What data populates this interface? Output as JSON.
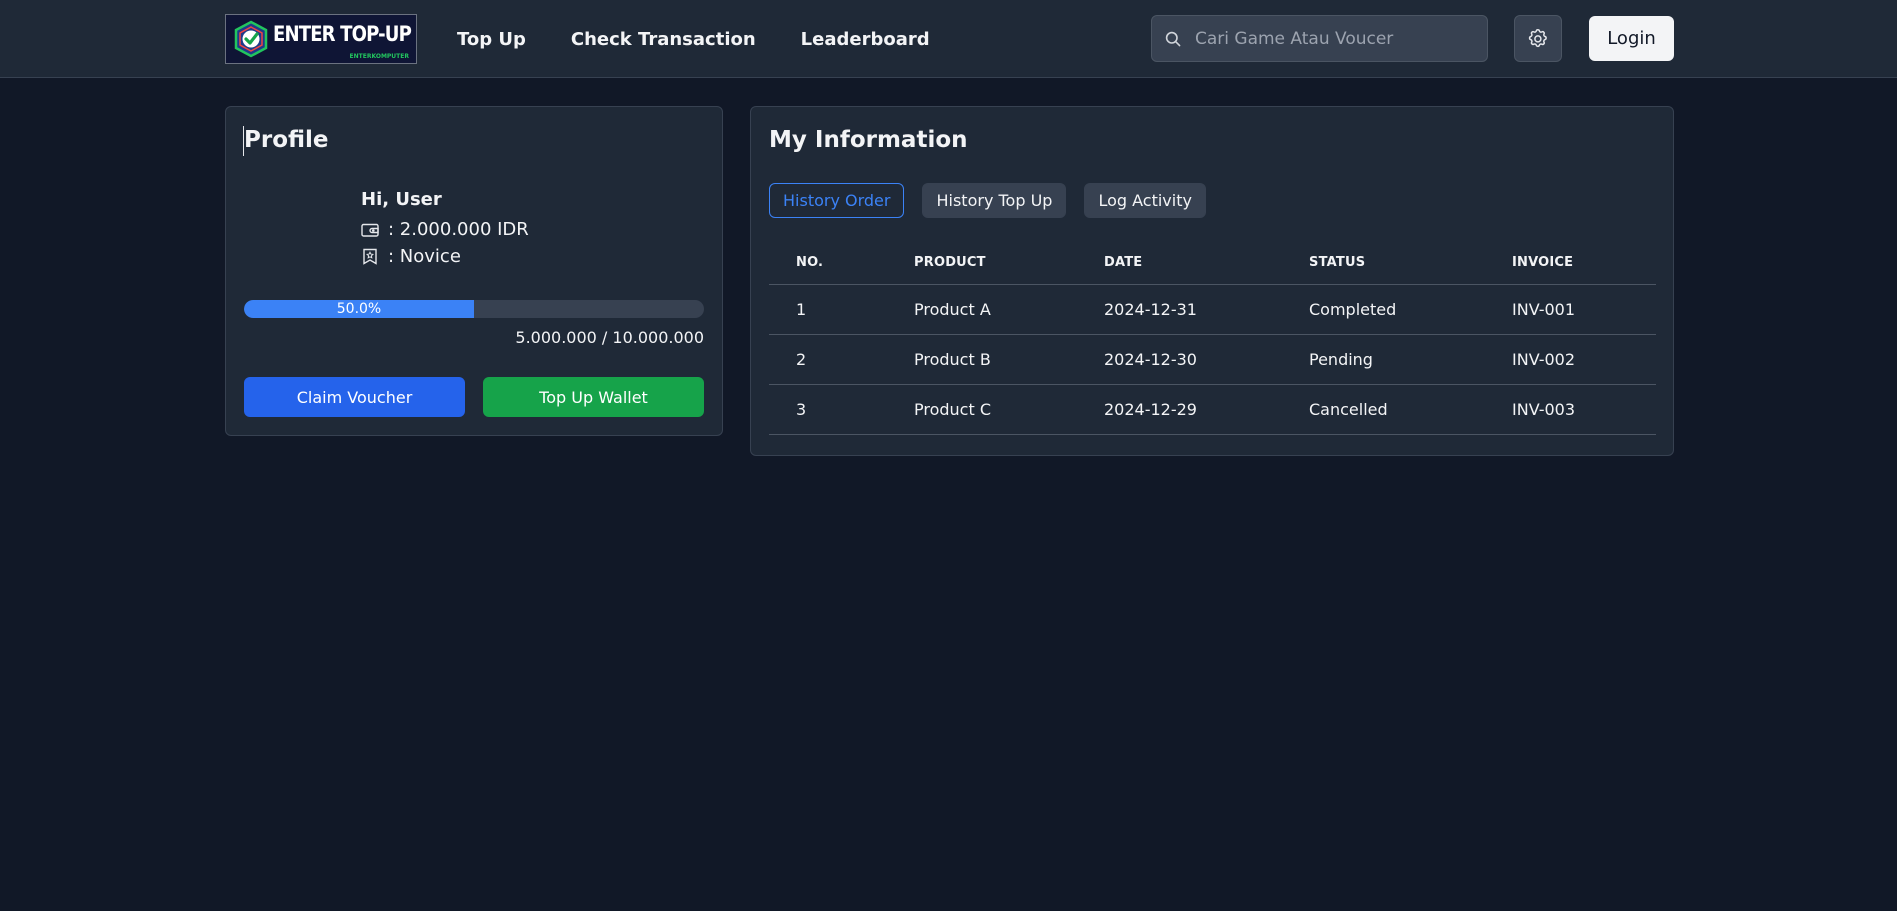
{
  "header": {
    "logo": {
      "text": "ENTER TOP-UP",
      "subtext": "ENTERKOMPUTER"
    },
    "nav": [
      {
        "label": "Top Up"
      },
      {
        "label": "Check Transaction"
      },
      {
        "label": "Leaderboard"
      }
    ],
    "search": {
      "placeholder": "Cari Game Atau Voucer"
    },
    "settings_icon": "gear-icon",
    "login_label": "Login"
  },
  "profile": {
    "title": "Profile",
    "greeting": "Hi, User",
    "balance": ": 2.000.000 IDR",
    "balance_icon": "wallet-icon",
    "rank": ": Novice",
    "rank_icon": "bookmark-badge-icon",
    "progress": {
      "percent": 50,
      "label": "50.0%",
      "caption": "5.000.000 / 10.000.000"
    },
    "claim_voucher_label": "Claim Voucher",
    "top_up_wallet_label": "Top Up Wallet"
  },
  "info": {
    "title": "My Information",
    "tabs": [
      {
        "label": "History Order",
        "active": true
      },
      {
        "label": "History Top Up",
        "active": false
      },
      {
        "label": "Log Activity",
        "active": false
      }
    ],
    "table": {
      "headers": [
        "NO.",
        "PRODUCT",
        "DATE",
        "STATUS",
        "INVOICE"
      ],
      "rows": [
        [
          "1",
          "Product A",
          "2024-12-31",
          "Completed",
          "INV-001"
        ],
        [
          "2",
          "Product B",
          "2024-12-30",
          "Pending",
          "INV-002"
        ],
        [
          "3",
          "Product C",
          "2024-12-29",
          "Cancelled",
          "INV-003"
        ]
      ]
    }
  },
  "colors": {
    "page_bg": "#111827",
    "surface": "#1f2937",
    "accent_blue": "#3b82f6",
    "button_blue": "#2563eb",
    "button_green": "#16a34a"
  }
}
